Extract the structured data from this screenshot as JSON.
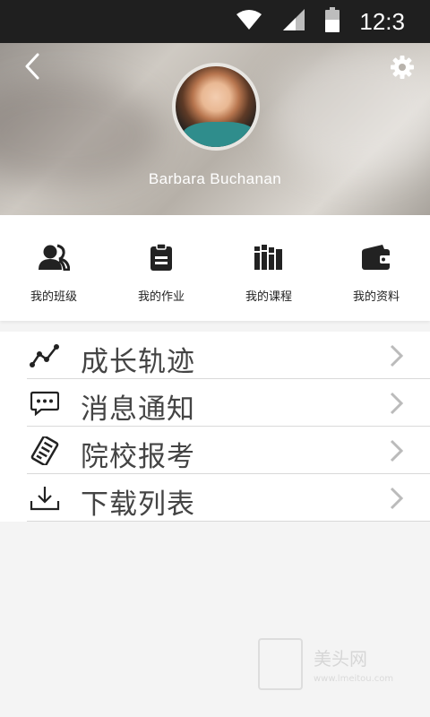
{
  "status_bar": {
    "time": "12:3",
    "icons": [
      "wifi-icon",
      "signal-icon",
      "battery-icon"
    ]
  },
  "profile": {
    "username": "Barbara Buchanan",
    "icons": [
      "back-icon",
      "settings-gear-icon",
      "avatar-photo"
    ]
  },
  "quick_links": [
    {
      "label": "我的班级",
      "icon": "class-users-icon"
    },
    {
      "label": "我的作业",
      "icon": "homework-clipboard-icon"
    },
    {
      "label": "我的课程",
      "icon": "courses-books-icon"
    },
    {
      "label": "我的资料",
      "icon": "profile-wallet-icon"
    }
  ],
  "menu": [
    {
      "label": "成长轨迹",
      "icon": "growth-trend-icon"
    },
    {
      "label": "消息通知",
      "icon": "message-chat-icon"
    },
    {
      "label": "院校报考",
      "icon": "application-form-icon"
    },
    {
      "label": "下载列表",
      "icon": "download-icon"
    }
  ],
  "watermark": {
    "name": "美头网",
    "url": "www.lmeitou.com"
  },
  "colors": {
    "status_bar_bg": "#1f1f1f",
    "content_bg": "#f4f4f4",
    "card_bg": "#ffffff",
    "menu_text": "#444444",
    "divider": "#d9d9d9"
  }
}
